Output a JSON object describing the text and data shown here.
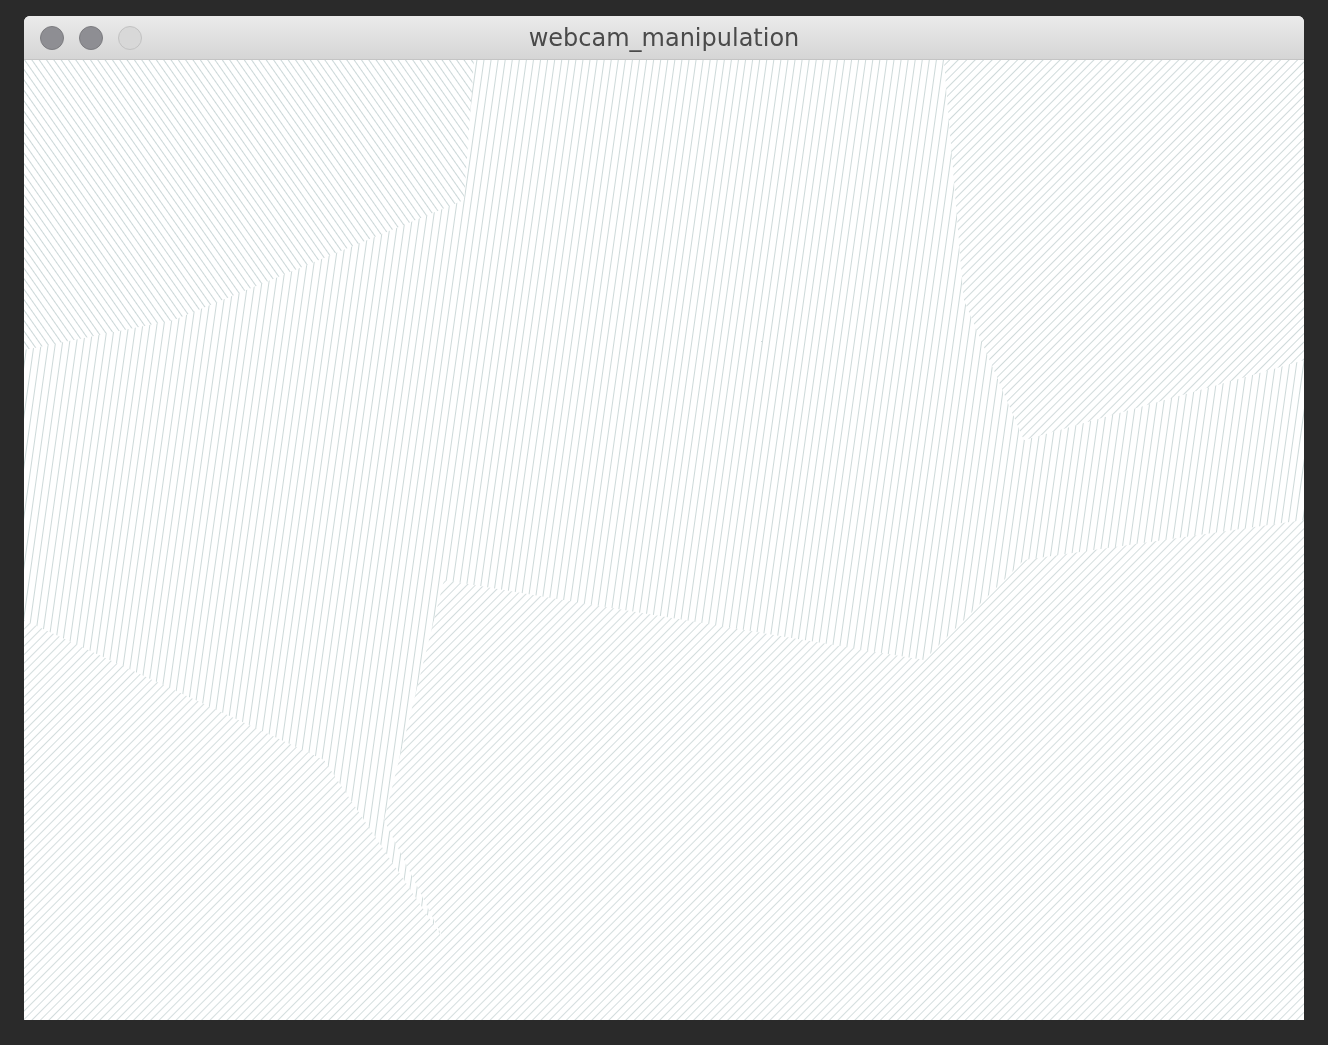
{
  "window": {
    "title": "webcam_manipulation"
  }
}
